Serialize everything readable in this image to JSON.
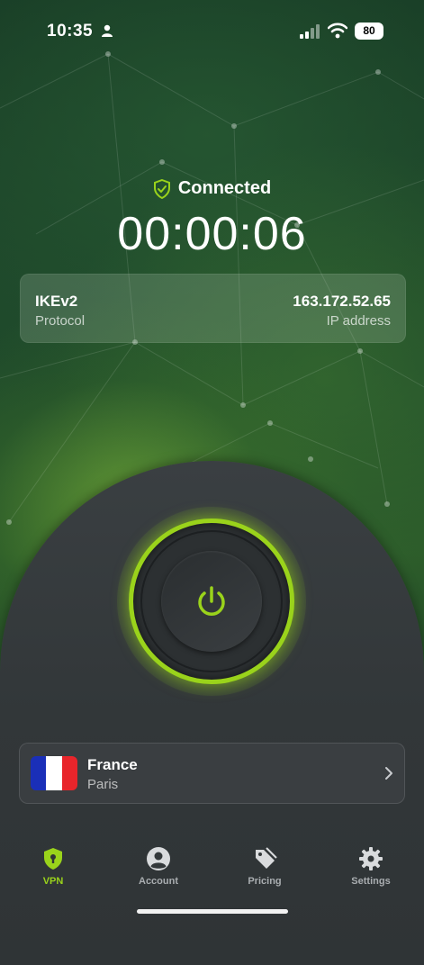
{
  "status_bar": {
    "time": "10:35",
    "battery": "80"
  },
  "connection": {
    "status": "Connected",
    "timer": "00:00:06"
  },
  "info": {
    "protocol_value": "IKEv2",
    "protocol_label": "Protocol",
    "ip_value": "163.172.52.65",
    "ip_label": "IP address"
  },
  "location": {
    "country": "France",
    "city": "Paris",
    "flag_colors": [
      "#1a2fb8",
      "#ffffff",
      "#e8252b"
    ]
  },
  "tabs": [
    {
      "label": "VPN",
      "icon": "shield-lock-icon",
      "active": true
    },
    {
      "label": "Account",
      "icon": "user-circle-icon",
      "active": false
    },
    {
      "label": "Pricing",
      "icon": "price-tag-icon",
      "active": false
    },
    {
      "label": "Settings",
      "icon": "gear-icon",
      "active": false
    }
  ],
  "colors": {
    "accent": "#9ad31b",
    "dome": "#33383a"
  }
}
